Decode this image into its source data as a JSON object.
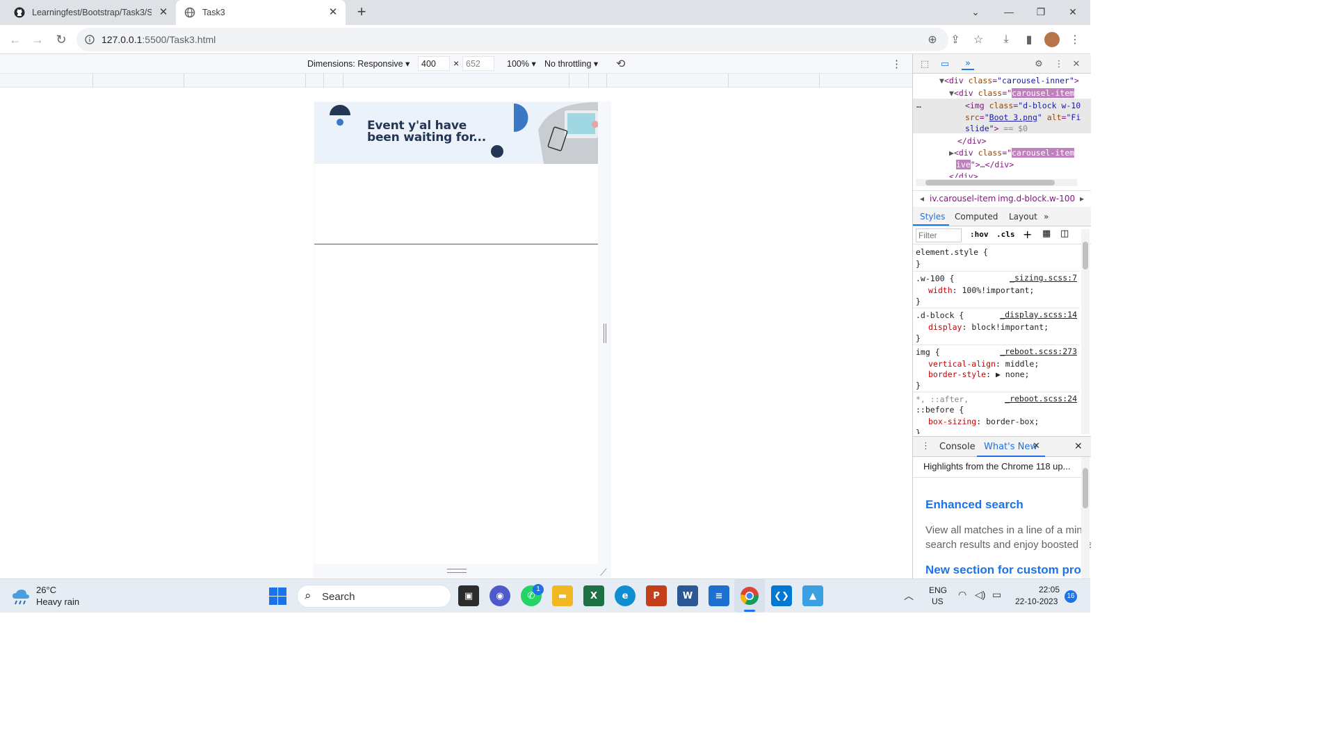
{
  "browser": {
    "tabs": [
      {
        "title": "Learningfest/Bootstrap/Task3/Sc",
        "icon": "github-icon",
        "active": false
      },
      {
        "title": "Task3",
        "icon": "globe-icon",
        "active": true
      }
    ],
    "url_host": "127.0.0.1",
    "url_path": ":5500/Task3.html"
  },
  "device_toolbar": {
    "dimensions_label": "Dimensions: Responsive",
    "width": "400",
    "height": "652",
    "times": "×",
    "zoom": "100%",
    "throttling": "No throttling"
  },
  "page": {
    "banner_text_line1": "Event y'al have",
    "banner_text_line2": "been waiting for...",
    "banner_bg": "#ebf2fa",
    "banner_text_color": "#243656"
  },
  "devtools": {
    "elements": [
      {
        "indent": 3,
        "text_tag": "▼<div ",
        "attr": "class",
        "val": "\"carousel-inner\"",
        "tail": ">"
      },
      {
        "indent": 4,
        "text_tag": "▼<div ",
        "attr": "class",
        "val_hl": "carousel-item",
        "tail": ""
      },
      {
        "indent": 5,
        "text_tag": "<img ",
        "attr": "class",
        "val": "\"d-block w-10",
        "tail": ""
      },
      {
        "indent": 5,
        "text_tag": "",
        "attr": "src",
        "val_link": "Boot 3.png",
        "tail2": " alt=\"Fi"
      },
      {
        "indent": 5,
        "text_tag": "slide\"> ",
        "tail": "== $0"
      },
      {
        "indent": 4,
        "text_tag": "</div>"
      },
      {
        "indent": 4,
        "text_tag": "▶<div ",
        "attr": "class",
        "val_hl": "carousel-item",
        "tail": ""
      },
      {
        "indent": 4,
        "text_tag": "",
        "val_hl2": "ive",
        "tail3": "\">…</div>"
      },
      {
        "indent": 4,
        "text_tag": "</div>"
      }
    ],
    "crumbs": [
      "iv.carousel-item",
      "img.d-block.w-100"
    ],
    "style_tabs": [
      "Styles",
      "Computed",
      "Layout"
    ],
    "filter_placeholder": "Filter",
    "filter_buttons": [
      ":hov",
      ".cls"
    ],
    "rules": [
      {
        "selector": "element.style {",
        "source": "",
        "props": [],
        "close": "}"
      },
      {
        "selector": ".w-100 {",
        "source": "_sizing.scss:7",
        "props": [
          {
            "name": "width",
            "value": "100%!important;"
          }
        ],
        "close": "}"
      },
      {
        "selector": ".d-block {",
        "source": "_display.scss:14",
        "props": [
          {
            "name": "display",
            "value": "block!important;"
          }
        ],
        "close": "}"
      },
      {
        "selector": "img {",
        "source": "_reboot.scss:273",
        "props": [
          {
            "name": "vertical-align",
            "value": "middle;"
          },
          {
            "name": "border-style",
            "value": "▶ none;"
          }
        ],
        "close": "}"
      },
      {
        "selector": "*, ::after,",
        "selector2": "::before {",
        "source": "_reboot.scss:24",
        "props": [
          {
            "name": "box-sizing",
            "value": "border-box;"
          }
        ],
        "close": "}"
      }
    ],
    "drawer_tabs": [
      "Console",
      "What's New"
    ],
    "drawer": {
      "highlight": "Highlights from the Chrome 118 up...",
      "heading1": "Enhanced search",
      "body1a": "View all matches in a line of a minif",
      "body1b": "search results and enjoy boosted se",
      "heading2": "New section for custom prop"
    }
  },
  "taskbar": {
    "weather_temp": "26°C",
    "weather_desc": "Heavy rain",
    "search_label": "Search",
    "whatsapp_badge": "1",
    "lang": "ENG",
    "region": "US",
    "time": "22:05",
    "date": "22-10-2023",
    "notifications": "16"
  },
  "colors": {
    "accent_blue": "#1a73e8",
    "devtools_highlight": "#c080c0",
    "link_blue": "#1a73e8"
  }
}
